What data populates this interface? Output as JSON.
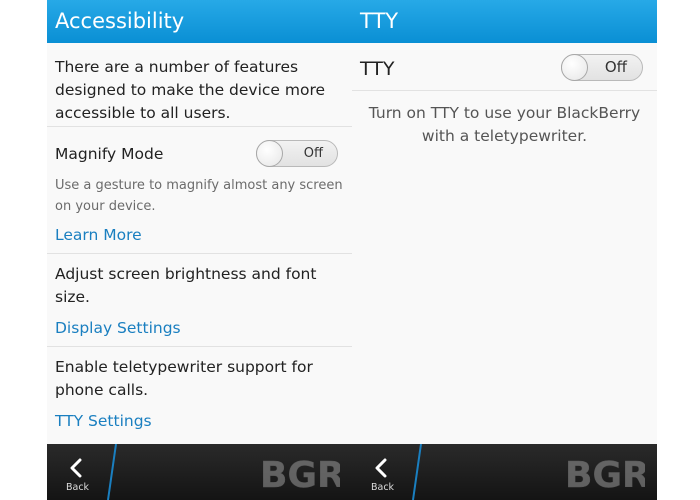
{
  "left": {
    "title": "Accessibility",
    "intro": "There are a number of features designed to make the device more accessible to all users.",
    "magnify": {
      "label": "Magnify Mode",
      "toggle_state": "Off",
      "description": "Use a gesture to magnify almost any screen on your device.",
      "link": "Learn More"
    },
    "display": {
      "description": "Adjust screen brightness and font size.",
      "link": "Display Settings"
    },
    "tty": {
      "description": "Enable teletypewriter support for phone calls.",
      "link": "TTY Settings"
    },
    "back_label": "Back"
  },
  "right": {
    "title": "TTY",
    "tty_label": "TTY",
    "toggle_state": "Off",
    "description": "Turn on TTY to use your BlackBerry with a teletypewriter.",
    "back_label": "Back"
  },
  "watermark": "BGR",
  "colors": {
    "titlebar": "#1a9fe0",
    "link": "#1a7fc0",
    "actionbar": "#1e1e1e",
    "accent_slash": "#1a7fc0"
  }
}
